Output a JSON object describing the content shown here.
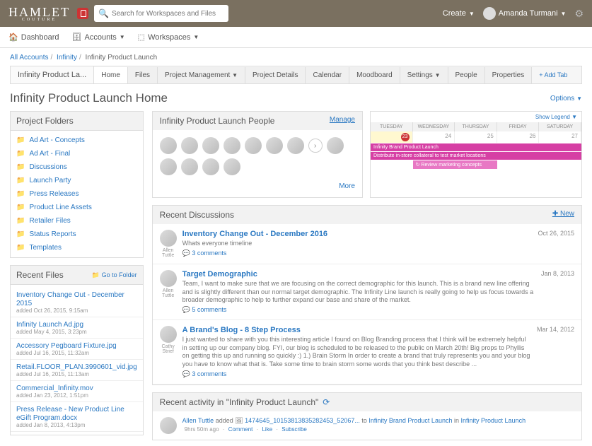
{
  "header": {
    "logo": "HAMLET",
    "logo_sub": "COUTURE",
    "search_placeholder": "Search for Workspaces and Files",
    "create": "Create",
    "user": "Amanda Turmani"
  },
  "nav": {
    "dashboard": "Dashboard",
    "accounts": "Accounts",
    "workspaces": "Workspaces"
  },
  "breadcrumb": {
    "all_accounts": "All Accounts",
    "infinity": "Infinity",
    "current": "Infinity Product Launch"
  },
  "tabs": {
    "label": "Infinity Product La...",
    "items": [
      "Home",
      "Files",
      "Project Management",
      "Project Details",
      "Calendar",
      "Moodboard",
      "Settings",
      "People",
      "Properties"
    ],
    "add": "+ Add Tab"
  },
  "page_title": "Infinity Product Launch Home",
  "options": "Options",
  "folders": {
    "title": "Project Folders",
    "items": [
      "Ad Art - Concepts",
      "Ad Art - Final",
      "Discussions",
      "Launch Party",
      "Press Releases",
      "Product Line Assets",
      "Retailer Files",
      "Status Reports",
      "Templates"
    ]
  },
  "recent": {
    "title": "Recent Files",
    "goto": "Go to Folder",
    "items": [
      {
        "name": "Inventory Change Out - December 2015",
        "meta": "added Oct 26, 2015, 9:15am"
      },
      {
        "name": "Infinity Launch Ad.jpg",
        "meta": "added May 4, 2015, 3:23pm"
      },
      {
        "name": "Accessory Pegboard Fixture.jpg",
        "meta": "added Jul 16, 2015, 11:32am"
      },
      {
        "name": "Retail.FLOOR_PLAN.3990601_vid.jpg",
        "meta": "added Jul 16, 2015, 11:13am"
      },
      {
        "name": "Commercial_Infinity.mov",
        "meta": "added Jan 23, 2012, 1:51pm"
      },
      {
        "name": "Press Release - New Product Line eGift Program.docx",
        "meta": "added Jan 8, 2013, 4:13pm"
      }
    ]
  },
  "people": {
    "title": "Infinity Product Launch People",
    "manage": "Manage",
    "more": "More"
  },
  "calendar": {
    "legend": "Show Legend",
    "days": [
      "TUESDAY",
      "WEDNESDAY",
      "THURSDAY",
      "FRIDAY",
      "SATURDAY"
    ],
    "nums": [
      "23",
      "24",
      "25",
      "26",
      "27"
    ],
    "events": [
      "Infinity Brand Product Launch",
      "Distribute in-store collateral to test market locations",
      "Review marketing concepts"
    ]
  },
  "discussions": {
    "title": "Recent Discussions",
    "new": "New",
    "items": [
      {
        "author": "Allen Tuttle",
        "title": "Inventory Change Out - December 2016",
        "text": "Whats everyone timeline",
        "comments": "3 comments",
        "date": "Oct 26, 2015"
      },
      {
        "author": "Allen Tuttle",
        "title": "Target Demographic",
        "text": "Team,   I want to make sure that we are focusing on the correct demographic for this launch. This is a brand new line offering and is slightly different than our normal target demographic. The Infinity Line launch is really going to help us focus towards a broader demographic to help to further expand our base and share of the market.",
        "comments": "5 comments",
        "date": "Jan 8, 2013"
      },
      {
        "author": "Cathy Strief",
        "title": "A Brand's Blog - 8 Step Process",
        "text": "I just wanted to share with you this interesting article I found on Blog Branding process that I think will be extremely helpful in setting up our company blog. FYI, our blog is scheduled to be released to the public on March 20th! Big props to Phyllis on getting this up and running so quickly :)  1.) Brain Storm In order to create a brand that truly represents you and your blog you have to know what that is. Take some time to brain storm some words that you think best describe ...",
        "comments": "3 comments",
        "date": "Mar 14, 2012"
      }
    ]
  },
  "activity": {
    "title": "Recent activity in \"Infinity Product Launch\"",
    "item": {
      "user": "Allen Tuttle",
      "action": "added",
      "file": "1474645_10153813835282453_52067...",
      "to": "to",
      "folder": "Infinity Brand Product Launch",
      "in": "in",
      "workspace": "Infinity Product Launch",
      "time": "9hrs 50m ago",
      "comment": "Comment",
      "like": "Like",
      "subscribe": "Subscribe"
    }
  }
}
